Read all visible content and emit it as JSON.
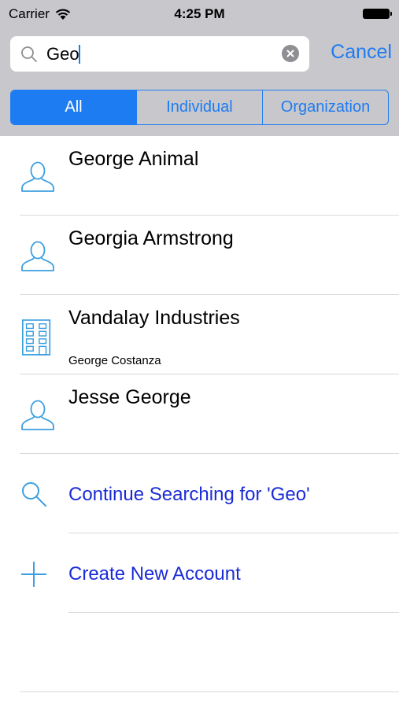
{
  "status_bar": {
    "carrier": "Carrier",
    "time": "4:25 PM"
  },
  "search": {
    "value": "Geo",
    "placeholder": "",
    "cancel_label": "Cancel"
  },
  "segments": [
    {
      "label": "All",
      "selected": true
    },
    {
      "label": "Individual",
      "selected": false
    },
    {
      "label": "Organization",
      "selected": false
    }
  ],
  "results": [
    {
      "title": "George Animal",
      "subtitle": "",
      "icon": "person-icon"
    },
    {
      "title": "Georgia Armstrong",
      "subtitle": "",
      "icon": "person-icon"
    },
    {
      "title": "Vandalay Industries",
      "subtitle": "George Costanza",
      "icon": "building-icon"
    },
    {
      "title": "Jesse George",
      "subtitle": "",
      "icon": "person-icon"
    }
  ],
  "actions": {
    "continue_search": "Continue Searching for 'Geo'",
    "create_account": "Create New Account"
  },
  "colors": {
    "accent": "#1e7cf2",
    "action_text": "#1a2bd6",
    "header_bg": "#c8c7cc",
    "icon_blue": "#3b9fe0"
  }
}
